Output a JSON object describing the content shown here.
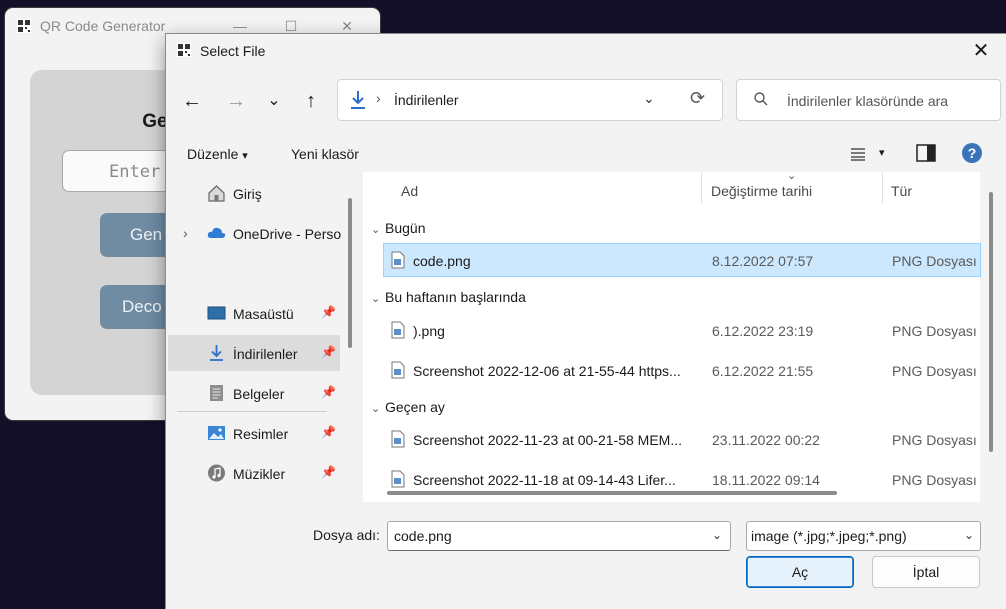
{
  "background_app": {
    "title": "QR Code Generator",
    "heading": "QR\nGenerator",
    "input_placeholder": "Enter",
    "generate_label": "Gen",
    "decode_label": "Deco",
    "controls": {
      "minimize": "—",
      "maximize": "☐",
      "close": "✕"
    }
  },
  "dialog": {
    "title": "Select File",
    "close": "✕",
    "nav": {
      "back": "←",
      "forward": "→",
      "recent": "⌄",
      "up": "↑"
    },
    "address": {
      "separator": "›",
      "path": "İndirilenler",
      "dropdown": "⌄",
      "refresh": "⟳"
    },
    "search_placeholder": "İndirilenler klasöründe ara",
    "toolbar": {
      "organize": "Düzenle",
      "organize_caret": "▾",
      "new_folder": "Yeni klasör",
      "view_caret": "▾",
      "help": "?"
    },
    "sidebar": {
      "items": [
        {
          "label": "Giriş",
          "icon": "home-icon",
          "pinned": false
        },
        {
          "label": "OneDrive - Perso",
          "icon": "cloud-icon",
          "pinned": false,
          "expander": "›"
        },
        {
          "label": "Masaüstü",
          "icon": "desktop-icon",
          "pinned": true
        },
        {
          "label": "İndirilenler",
          "icon": "download-icon",
          "pinned": true,
          "selected": true
        },
        {
          "label": "Belgeler",
          "icon": "document-icon",
          "pinned": true
        },
        {
          "label": "Resimler",
          "icon": "picture-icon",
          "pinned": true
        },
        {
          "label": "Müzikler",
          "icon": "music-icon",
          "pinned": true
        }
      ],
      "pin_glyph": "📌"
    },
    "columns": {
      "name": "Ad",
      "date": "Değiştirme tarihi",
      "type": "Tür",
      "sort_glyph": "⌄"
    },
    "groups": [
      {
        "label": "Bugün",
        "chevron": "⌄"
      },
      {
        "label": "Bu haftanın başlarında",
        "chevron": "⌄"
      },
      {
        "label": "Geçen ay",
        "chevron": "⌄"
      }
    ],
    "files": [
      {
        "name": "code.png",
        "date": "8.12.2022 07:57",
        "type": "PNG Dosyası",
        "selected": true
      },
      {
        "name": ").png",
        "date": "6.12.2022 23:19",
        "type": "PNG Dosyası"
      },
      {
        "name": "Screenshot 2022-12-06 at 21-55-44 https...",
        "date": "6.12.2022 21:55",
        "type": "PNG Dosyası"
      },
      {
        "name": "Screenshot 2022-11-23 at 00-21-58 MEM...",
        "date": "23.11.2022 00:22",
        "type": "PNG Dosyası"
      },
      {
        "name": "Screenshot 2022-11-18 at 09-14-43 Lifer...",
        "date": "18.11.2022 09:14",
        "type": "PNG Dosyası"
      }
    ],
    "filename_label": "Dosya adı:",
    "filename_value": "code.png",
    "filetype_value": "image (*.jpg;*.jpeg;*.png)",
    "combo_caret": "⌄",
    "ok_label": "Aç",
    "cancel_label": "İptal"
  }
}
